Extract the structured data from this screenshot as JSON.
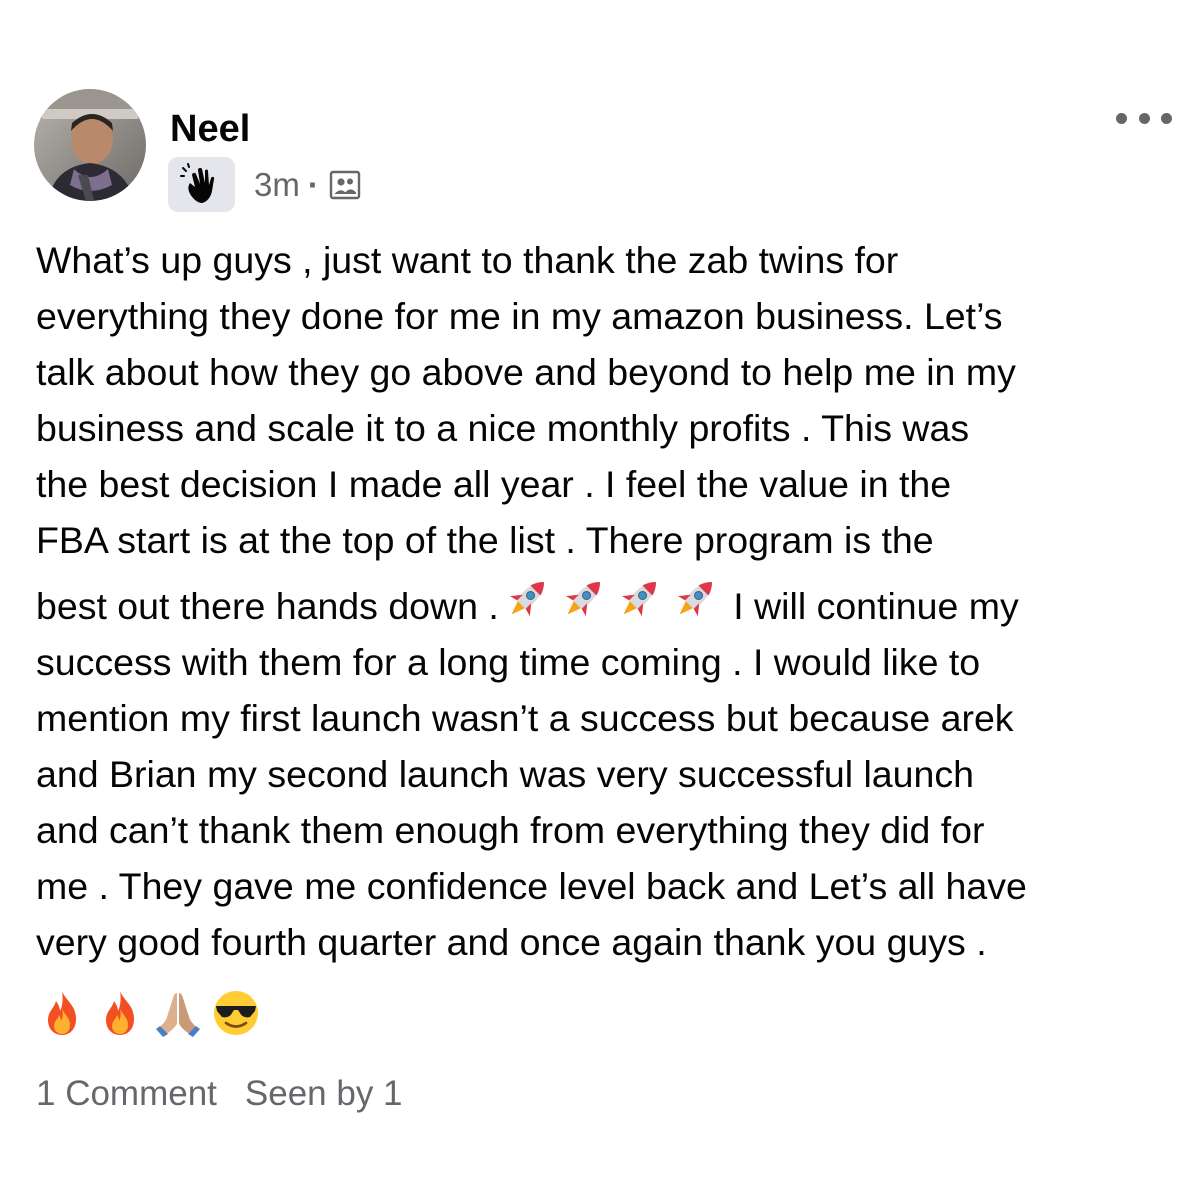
{
  "post": {
    "author": "Neel",
    "badge_icon": "waving-hand-icon",
    "time": "3m",
    "separator": "·",
    "audience_icon": "members-group-icon",
    "more_icon": "more-options-icon",
    "lines": [
      "What’s up guys , just want to thank the zab twins for",
      "everything they done for me in my amazon business. Let’s",
      "talk about how they go above and beyond to help me in my",
      "business and scale it to a nice monthly profits . This was",
      "the best decision I made all year . I feel the value in the",
      "FBA start is at the top of the list . There program is the"
    ],
    "rocket_line_before": "best out there hands down .",
    "rocket_emojis": [
      "🚀",
      "🚀",
      "🚀",
      "🚀"
    ],
    "rocket_line_after": " I will continue my",
    "lines_after": [
      "success with them for a long time coming . I would like to",
      "mention my first launch wasn’t a success but because arek",
      "and Brian my second launch was very successful launch",
      "and can’t thank them enough from everything they did for",
      "me . They gave me confidence level back and Let’s all have",
      "very good fourth quarter and once again thank you guys ."
    ],
    "closing_emojis": [
      "fire-emoji",
      "fire-emoji",
      "folded-hands-emoji",
      "sunglasses-face-emoji"
    ]
  },
  "footer": {
    "comments": "1 Comment",
    "seen_by": "Seen by 1"
  },
  "colors": {
    "text": "#050505",
    "secondary": "#65676b",
    "badge_bg": "#e4e6eb"
  }
}
